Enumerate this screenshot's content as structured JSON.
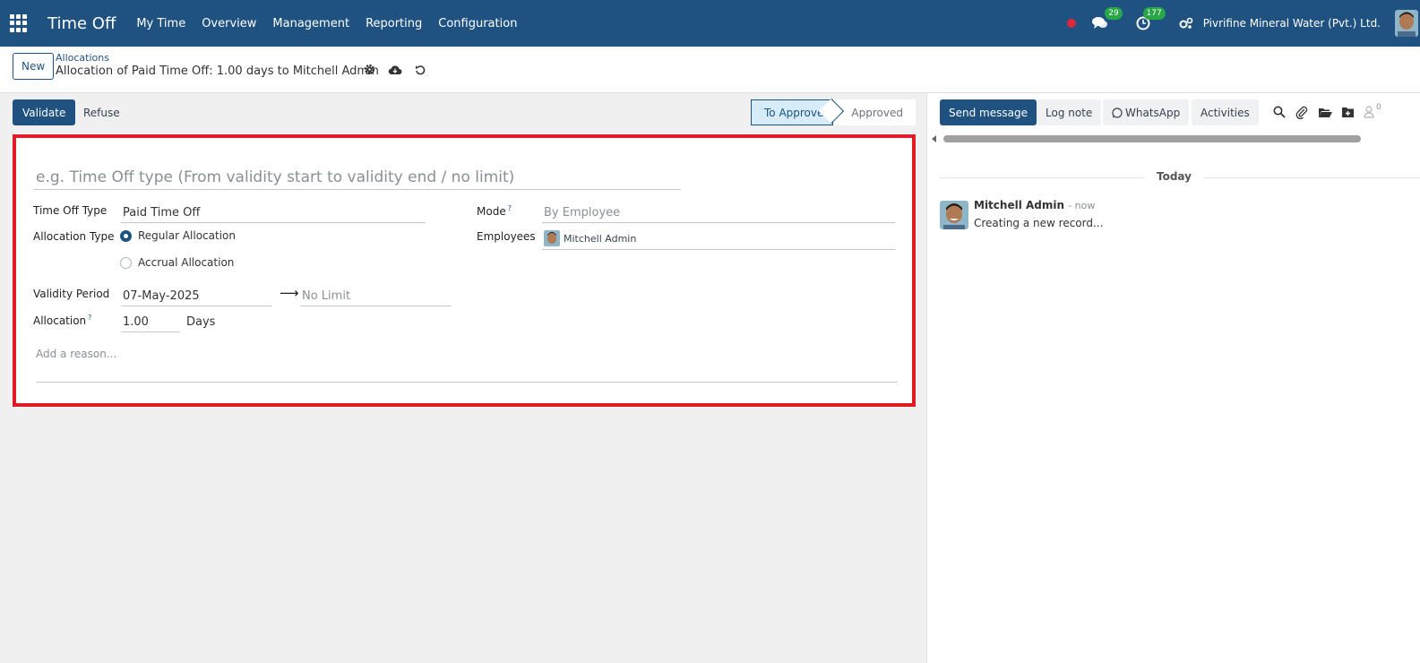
{
  "navbar": {
    "app_title": "Time Off",
    "menu": [
      "My Time",
      "Overview",
      "Management",
      "Reporting",
      "Configuration"
    ],
    "messages_count": "29",
    "activities_count": "177",
    "company": "Pivrifine Mineral Water (Pvt.) Ltd.",
    "accent_color": "#1f5281"
  },
  "control_panel": {
    "new_label": "New",
    "breadcrumb_parent": "Allocations",
    "breadcrumb_current": "Allocation of Paid Time Off: 1.00 days to Mitchell Admin"
  },
  "form": {
    "validate_label": "Validate",
    "refuse_label": "Refuse",
    "stage_active": "To Approve",
    "stage_next": "Approved",
    "name_placeholder": "e.g. Time Off type (From validity start to validity end / no limit)",
    "time_off_type_label": "Time Off Type",
    "time_off_type_value": "Paid Time Off",
    "allocation_type_label": "Allocation Type",
    "allocation_type_options": [
      "Regular Allocation",
      "Accrual Allocation"
    ],
    "allocation_type_selected": "Regular Allocation",
    "validity_label": "Validity Period",
    "validity_start": "07-May-2025",
    "validity_end_placeholder": "No Limit",
    "allocation_label": "Allocation",
    "allocation_value": "1.00",
    "allocation_unit": "Days",
    "help_mark": "?",
    "mode_label": "Mode",
    "mode_value": "By Employee",
    "employees_label": "Employees",
    "employee_name": "Mitchell Admin",
    "reason_placeholder": "Add a reason...",
    "highlight_color": "#e01b24"
  },
  "chatter": {
    "send_message_label": "Send message",
    "log_note_label": "Log note",
    "whatsapp_label": "WhatsApp",
    "activities_label": "Activities",
    "followers_count": "0",
    "separator": "Today",
    "message_author": "Mitchell Admin",
    "message_time": "- now",
    "message_body": "Creating a new record..."
  }
}
